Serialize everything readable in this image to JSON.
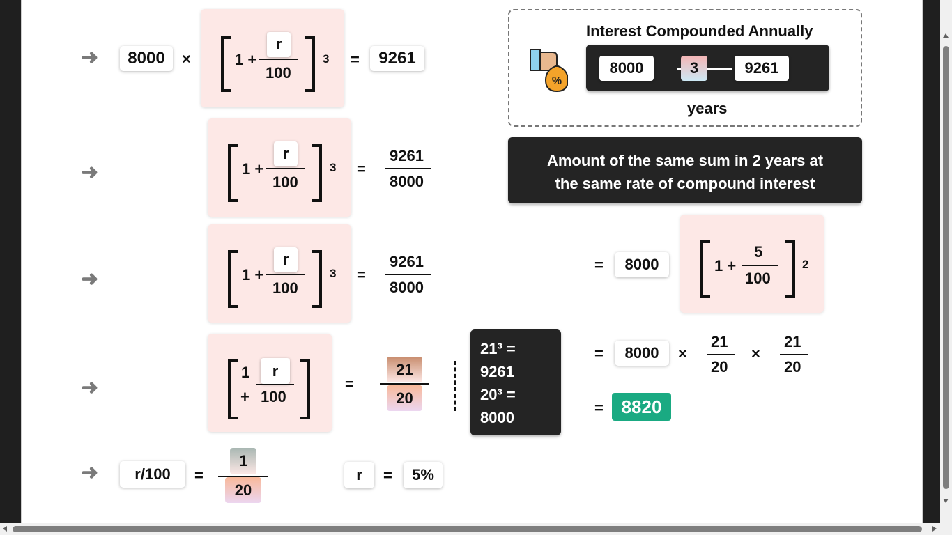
{
  "colors": {
    "accent": "#1aaa82",
    "dark_panel": "#242424",
    "pink_box": "#fde8e6"
  },
  "arrow_glyph": "➜",
  "row1": {
    "a": "8000",
    "times": "×",
    "one_plus": "1 +",
    "r": "r",
    "hundred": "100",
    "exp": "3",
    "eq": "=",
    "result": "9261"
  },
  "row2": {
    "one_plus": "1 +",
    "r": "r",
    "hundred": "100",
    "exp": "3",
    "eq": "=",
    "num": "9261",
    "den": "8000"
  },
  "row3": {
    "one_plus": "1 +",
    "r": "r",
    "hundred": "100",
    "exp": "3",
    "eq": "=",
    "num": "9261",
    "den": "8000"
  },
  "row4": {
    "one": "1",
    "plus": "+",
    "r": "r",
    "hundred": "100",
    "eq": "=",
    "num": "21",
    "den": "20"
  },
  "row5": {
    "lhs": "r/100",
    "eq": "=",
    "num": "1",
    "den": "20",
    "r": "r",
    "eq2": "=",
    "value": "5%"
  },
  "card": {
    "title": "Interest Compounded Annually",
    "principal": "8000",
    "years_value": "3",
    "amount": "9261",
    "years_label": "years",
    "icon": "money-bag-percent-icon"
  },
  "banner": {
    "line1": "Amount of the same sum in 2 years at",
    "line2": "the same rate of compound interest"
  },
  "cubes": {
    "l1": "21³ =",
    "l2": "9261",
    "l3": "20³ =",
    "l4": "8000"
  },
  "result1": {
    "eq": "=",
    "p": "8000",
    "one_plus": "1 +",
    "num": "5",
    "den": "100",
    "exp": "2"
  },
  "result2": {
    "eq": "=",
    "p": "8000",
    "times1": "×",
    "n1": "21",
    "d1": "20",
    "times2": "×",
    "n2": "21",
    "d2": "20"
  },
  "result3": {
    "eq": "=",
    "answer": "8820"
  }
}
